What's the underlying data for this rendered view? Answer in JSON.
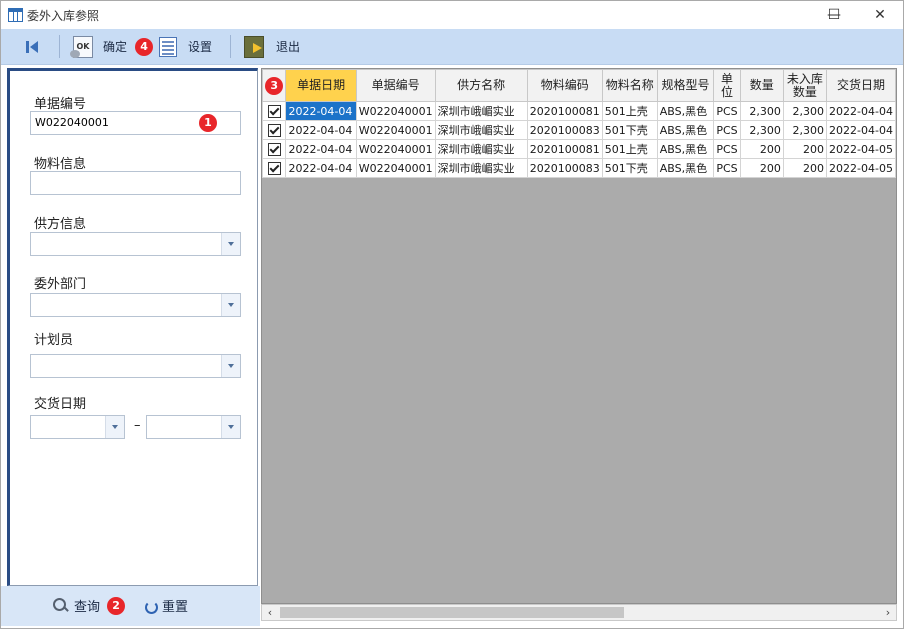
{
  "window": {
    "title": "委外入库参照",
    "minimize": "—",
    "maximize": "☐",
    "close": "✕"
  },
  "toolbar": {
    "confirm_label": "确定",
    "settings_label": "设置",
    "exit_label": "退出",
    "badge4": "4"
  },
  "filters": {
    "doc_no_label": "单据编号",
    "doc_no_value": "W022040001",
    "material_label": "物料信息",
    "material_value": "",
    "supplier_label": "供方信息",
    "supplier_value": "",
    "dept_label": "委外部门",
    "dept_value": "",
    "planner_label": "计划员",
    "planner_value": "",
    "delivery_label": "交货日期",
    "date_from": "",
    "date_sep": "–",
    "date_to": "",
    "badge1": "1"
  },
  "actions": {
    "query_label": "查询",
    "reset_label": "重置",
    "badge2": "2"
  },
  "grid": {
    "badge3": "3",
    "columns": [
      "单据日期",
      "单据编号",
      "供方名称",
      "物料编码",
      "物料名称",
      "规格型号",
      "单\n位",
      "数量",
      "未入库\n数量",
      "交货日期"
    ],
    "rows": [
      [
        "2022-04-04",
        "W022040001",
        "深圳市峨嵋实业",
        "2020100081",
        "501上壳",
        "ABS,黑色",
        "PCS",
        "2,300",
        "2,300",
        "2022-04-04"
      ],
      [
        "2022-04-04",
        "W022040001",
        "深圳市峨嵋实业",
        "2020100083",
        "501下壳",
        "ABS,黑色",
        "PCS",
        "2,300",
        "2,300",
        "2022-04-04"
      ],
      [
        "2022-04-04",
        "W022040001",
        "深圳市峨嵋实业",
        "2020100081",
        "501上壳",
        "ABS,黑色",
        "PCS",
        "200",
        "200",
        "2022-04-05"
      ],
      [
        "2022-04-04",
        "W022040001",
        "深圳市峨嵋实业",
        "2020100083",
        "501下壳",
        "ABS,黑色",
        "PCS",
        "200",
        "200",
        "2022-04-05"
      ]
    ],
    "scroll_left": "‹",
    "scroll_right": "›"
  },
  "colors": {
    "toolbar_bg": "#c8dcf4",
    "active_header": "#ffd24d",
    "selected_cell": "#1c73c9",
    "badge": "#e8262a"
  }
}
